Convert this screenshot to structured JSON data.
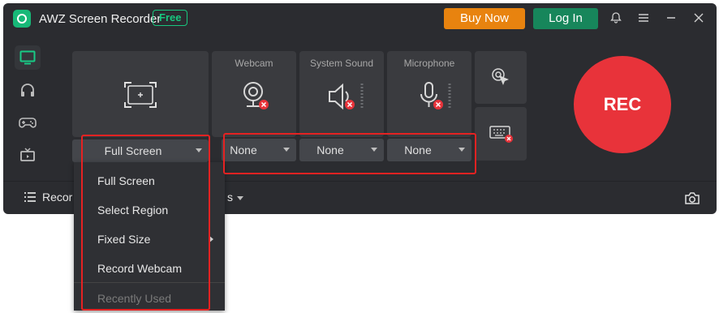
{
  "titlebar": {
    "app_title": "AWZ Screen Recorder",
    "badge": "Free",
    "buy_label": "Buy Now",
    "login_label": "Log In",
    "icons": [
      "bell-icon",
      "menu-icon",
      "minimize-icon",
      "close-icon"
    ]
  },
  "sidebar": {
    "items": [
      {
        "name": "screen",
        "icon": "monitor-icon",
        "active": true
      },
      {
        "name": "audio",
        "icon": "headphones-icon",
        "active": false
      },
      {
        "name": "game",
        "icon": "gamepad-icon",
        "active": false
      },
      {
        "name": "tv",
        "icon": "tv-icon",
        "active": false
      }
    ]
  },
  "panels": {
    "screen_area": {
      "selected": "Full Screen"
    },
    "webcam": {
      "label": "Webcam",
      "selected": "None"
    },
    "system_sound": {
      "label": "System Sound",
      "selected": "None"
    },
    "microphone": {
      "label": "Microphone",
      "selected": "None"
    }
  },
  "rec_label": "REC",
  "bottom": {
    "records_label": "Recor",
    "partial_label": "s"
  },
  "menu": {
    "items": [
      "Full Screen",
      "Select Region",
      "Fixed Size",
      "Record Webcam"
    ],
    "recently_used": "Recently Used"
  },
  "colors": {
    "accent": "#18c77f",
    "buy": "#e8830f",
    "login": "#17865b",
    "rec": "#e8333a",
    "highlight": "#e52222"
  }
}
